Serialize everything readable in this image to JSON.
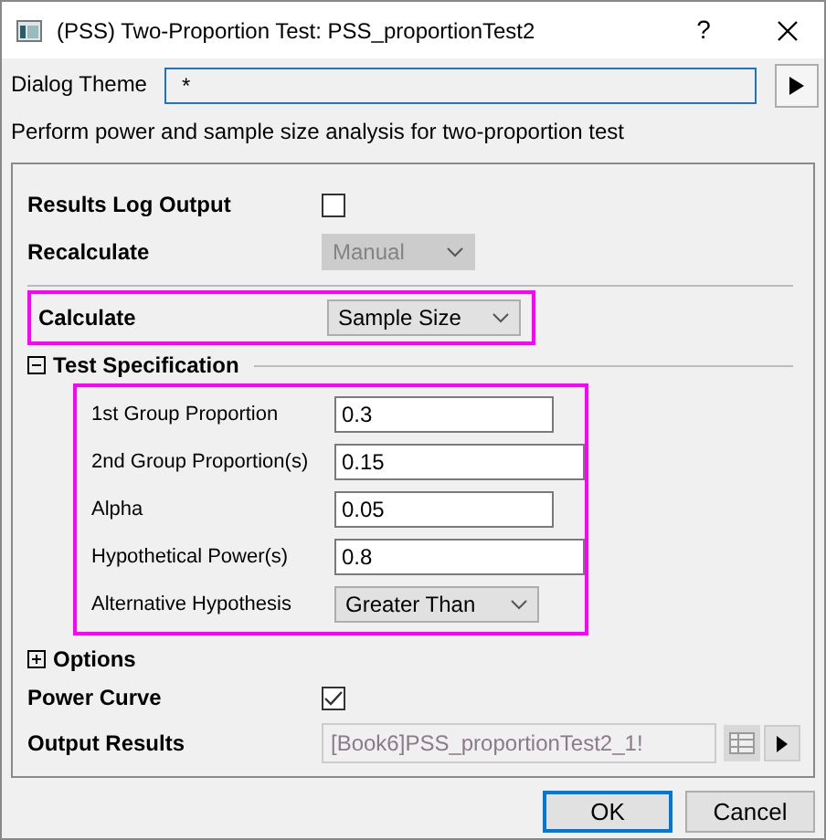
{
  "window": {
    "title": "(PSS) Two-Proportion Test: PSS_proportionTest2",
    "help": "?"
  },
  "dialog_theme": {
    "label": "Dialog Theme",
    "value": "*"
  },
  "description": "Perform power and sample size analysis for two-proportion test",
  "top_rows": [
    {
      "label": "Results Log Output",
      "kind": "checkbox",
      "checked": false
    },
    {
      "label": "Recalculate",
      "kind": "dropdown",
      "value": "Manual",
      "disabled": true
    }
  ],
  "calculate": {
    "label": "Calculate",
    "value": "Sample Size",
    "highlighted": true
  },
  "test_specification": {
    "title": "Test Specification",
    "expanded": true,
    "highlighted": true,
    "rows": [
      {
        "label": "1st Group Proportion",
        "kind": "short_field",
        "value": "0.3"
      },
      {
        "label": "2nd Group Proportion(s)",
        "kind": "long_field",
        "value": "0.15"
      },
      {
        "label": "Alpha",
        "kind": "short_field",
        "value": "0.05"
      },
      {
        "label": "Hypothetical Power(s)",
        "kind": "long_field",
        "value": "0.8"
      },
      {
        "label": "Alternative Hypothesis",
        "kind": "dropdown",
        "value": "Greater Than"
      }
    ]
  },
  "options": {
    "title": "Options",
    "expanded": false
  },
  "bottom_rows": [
    {
      "label": "Power Curve",
      "kind": "checkbox",
      "checked": true
    },
    {
      "label": "Output Results",
      "kind": "output",
      "value": "[Book6]PSS_proportionTest2_1!",
      "disabled": true
    }
  ],
  "buttons": [
    {
      "label": "OK",
      "default": true
    },
    {
      "label": "Cancel",
      "default": false
    }
  ]
}
